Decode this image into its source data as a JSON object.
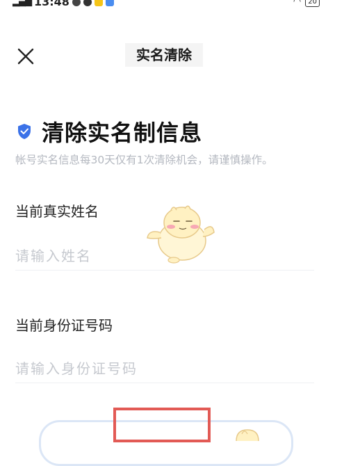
{
  "status": {
    "time": "13:48",
    "battery": "20"
  },
  "nav": {
    "title": "实名清除"
  },
  "heading": "清除实名制信息",
  "subtitle": "帐号实名信息每30天仅有1次清除机会，请谨慎操作。",
  "form": {
    "name_label": "当前真实姓名",
    "name_placeholder": "请输入姓名",
    "id_label": "当前身份证号码",
    "id_placeholder": "请输入身份证号码"
  },
  "colors": {
    "accent": "#3b72e8",
    "highlight": "#e25a55"
  }
}
